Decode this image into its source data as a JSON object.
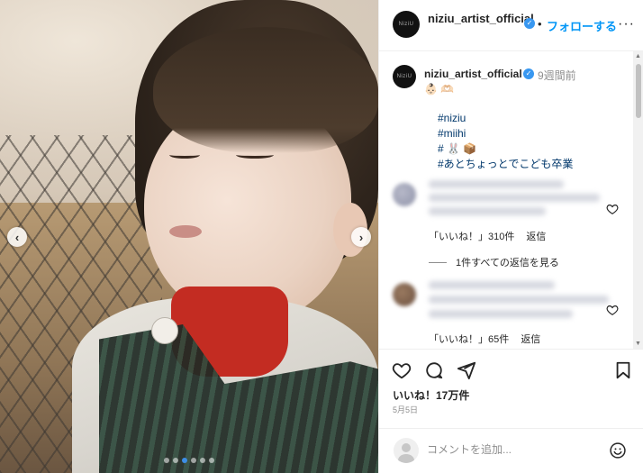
{
  "post": {
    "username": "niziu_artist_official",
    "avatar_text": "NiziU",
    "follow_separator": "•",
    "follow_label": "フォローする",
    "more_label": "···",
    "caption": {
      "time": "9週間前",
      "emoji": "👶🏻 🫶🏻",
      "hashtags": [
        "#niziu",
        "#miihi",
        "# 🐰 📦",
        "#あとちょっとでこども卒業"
      ]
    },
    "comments": [
      {
        "likes": "「いいね！」310件",
        "reply": "返信"
      },
      {
        "likes": "「いいね！」65件",
        "reply": "返信"
      }
    ],
    "view_replies": "1件すべての返信を見る",
    "likes_count": "いいね！17万件",
    "date": "5月5日",
    "comment_placeholder": "コメントを追加...",
    "carousel": {
      "total": 6,
      "active": 3
    }
  },
  "colors": {
    "link": "#0095f6",
    "hashtag": "#00376b",
    "verified": "#3897f0",
    "muted": "#8e8e8e"
  },
  "icons": [
    "verified-icon",
    "more-icon",
    "heart-icon",
    "comment-icon",
    "share-icon",
    "bookmark-icon",
    "emoji-icon",
    "chevron-left-icon",
    "chevron-right-icon"
  ]
}
